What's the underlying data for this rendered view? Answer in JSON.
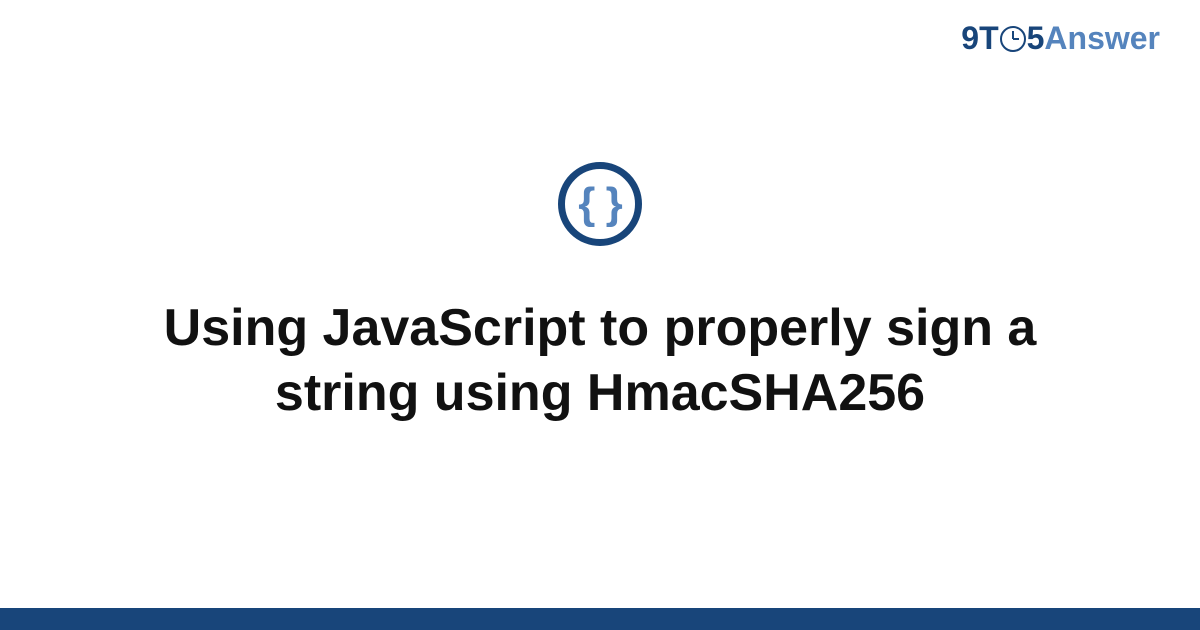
{
  "brand": {
    "nine_t": "9T",
    "five": "5",
    "answer": "Answer"
  },
  "icon": {
    "braces": "{ }"
  },
  "title": "Using JavaScript to properly sign a string using HmacSHA256",
  "colors": {
    "primary": "#18457a",
    "accent": "#5584bd"
  }
}
